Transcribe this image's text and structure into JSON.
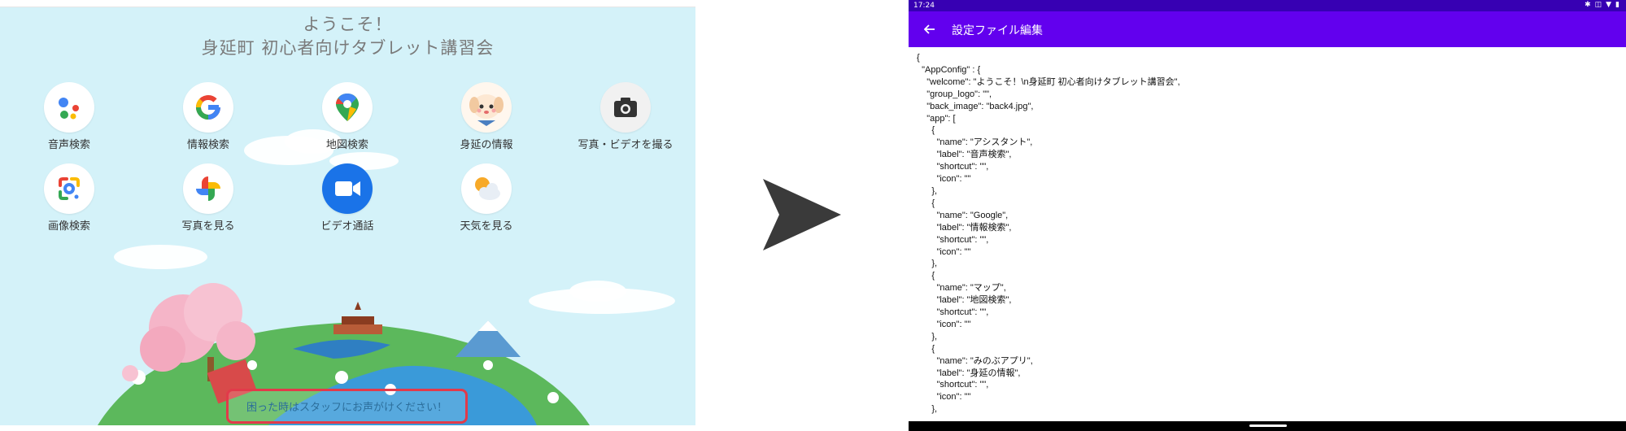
{
  "tablet": {
    "welcome_line1": "ようこそ！",
    "welcome_line2": "身延町 初心者向けタブレット講習会",
    "apps": [
      {
        "label": "音声検索",
        "icon": "google-assistant-icon"
      },
      {
        "label": "情報検索",
        "icon": "google-icon"
      },
      {
        "label": "地図検索",
        "icon": "google-maps-icon"
      },
      {
        "label": "身延の情報",
        "icon": "minobu-mascot-icon"
      },
      {
        "label": "写真・ビデオを撮る",
        "icon": "camera-icon"
      },
      {
        "label": "画像検索",
        "icon": "google-lens-icon"
      },
      {
        "label": "写真を見る",
        "icon": "google-photos-icon"
      },
      {
        "label": "ビデオ通話",
        "icon": "video-call-icon"
      },
      {
        "label": "天気を見る",
        "icon": "weather-icon"
      }
    ],
    "footer_message": "困った時はスタッフにお声がけください！",
    "colors": {
      "background": "#d4f2f9",
      "highlight_border": "#e23a4a"
    }
  },
  "phone": {
    "status_time": "17:24",
    "status_icons": [
      "bluetooth-icon",
      "vibrate-icon",
      "wifi-icon",
      "battery-icon"
    ],
    "title": "設定ファイル編集",
    "back_icon": "arrow-back-icon",
    "editor_content": "{\n  \"AppConfig\" : {\n    \"welcome\": \"ようこそ！\\n身延町 初心者向けタブレット講習会\",\n    \"group_logo\": \"\",\n    \"back_image\": \"back4.jpg\",\n    \"app\": [\n      {\n        \"name\": \"アシスタント\",\n        \"label\": \"音声検索\",\n        \"shortcut\": \"\",\n        \"icon\": \"\"\n      },\n      {\n        \"name\": \"Google\",\n        \"label\": \"情報検索\",\n        \"shortcut\": \"\",\n        \"icon\": \"\"\n      },\n      {\n        \"name\": \"マップ\",\n        \"label\": \"地図検索\",\n        \"shortcut\": \"\",\n        \"icon\": \"\"\n      },\n      {\n        \"name\": \"みのぶアプリ\",\n        \"label\": \"身延の情報\",\n        \"shortcut\": \"\",\n        \"icon\": \"\"\n      },",
    "colors": {
      "statusbar": "#3700b3",
      "appbar": "#6200ee"
    }
  }
}
